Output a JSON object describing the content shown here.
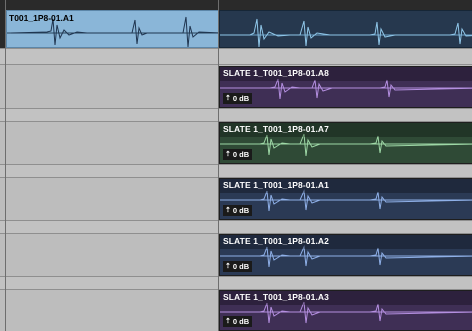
{
  "colors": {
    "selection_blue": "#8ab6d8",
    "clip_A8": "#3f2f55",
    "clip_A7": "#2f4a36",
    "clip_A1": "#2b3a55",
    "clip_A2": "#2b3a55",
    "clip_A3": "#3f2f55",
    "wave_blue": "#8fc6e8",
    "wave_purple": "#b48fe0",
    "wave_green": "#9ed8a6"
  },
  "tracks": [
    {
      "clip_name": "T001_1P8-01.A1"
    },
    {
      "clip_name": "SLATE 1_T001_1P8-01.A8",
      "gain": "0 dB",
      "gain_icon": "clip-gain-icon"
    },
    {
      "clip_name": "SLATE 1_T001_1P8-01.A7",
      "gain": "0 dB",
      "gain_icon": "clip-gain-icon"
    },
    {
      "clip_name": "SLATE 1_T001_1P8-01.A1",
      "gain": "0 dB",
      "gain_icon": "clip-gain-icon"
    },
    {
      "clip_name": "SLATE 1_T001_1P8-01.A2",
      "gain": "0 dB",
      "gain_icon": "clip-gain-icon"
    },
    {
      "clip_name": "SLATE 1_T001_1P8-01.A3",
      "gain": "0 dB",
      "gain_icon": "clip-gain-icon"
    }
  ]
}
